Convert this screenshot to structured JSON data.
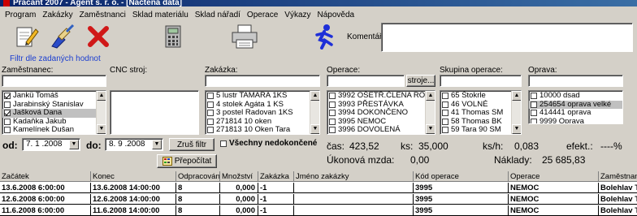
{
  "window": {
    "title": "Pracant 2007 - Agent s. r. o. - [Načtená data]"
  },
  "menu": [
    "Program",
    "Zakázky",
    "Zaměstnanci",
    "Sklad materiálu",
    "Sklad nářadí",
    "Operace",
    "Výkazy",
    "Nápověda"
  ],
  "toolbar": {
    "comment_label": "Komentář:",
    "comment_value": ""
  },
  "filter": {
    "title": "Filtr dle zadaných hodnot",
    "employee_label": "Zaměstnanec:",
    "cnc_label": "CNC stroj:",
    "order_label": "Zakázka:",
    "operation_label": "Operace:",
    "machines_button": "stroje...",
    "op_group_label": "Skupina operace:",
    "repair_label": "Oprava:",
    "employee_value": "",
    "order_value": "",
    "operation_value": "",
    "op_group_value": "",
    "repair_value": ""
  },
  "employees": [
    {
      "label": "Jankü Tomáš",
      "checked": true,
      "selected": false
    },
    {
      "label": "Jarabinský Stanislav",
      "checked": false,
      "selected": false
    },
    {
      "label": "Jašková Dana",
      "checked": true,
      "selected": true
    },
    {
      "label": "Kadaňka Jakub",
      "checked": false,
      "selected": false
    },
    {
      "label": "Kamelínek Dušan",
      "checked": false,
      "selected": false
    }
  ],
  "orders": [
    "5 lustr TAMARA 1KS",
    "4 stolek Agáta 1 KS",
    "3 postel Radovan 1KS",
    "271814 10 oken",
    "271813 10 Oken Tara"
  ],
  "operations": [
    "3992 OŠETŘ.ČLENA RO",
    "3993 PŘESTÁVKA",
    "3994 DOKONČENO",
    "3995 NEMOC",
    "3996 DOVOLENÁ"
  ],
  "op_groups": [
    "65 Štokrle",
    "46 VOLNÉ",
    "41 Thomas  SM",
    "58 Thomas  BK",
    "59 Tara 90 SM"
  ],
  "repairs": [
    {
      "label": "10000 dsad",
      "selected": false
    },
    {
      "label": "254654 oprava velké",
      "selected": true
    },
    {
      "label": "414441 oprava",
      "selected": false
    },
    {
      "label": "9999 Oprava",
      "selected": false
    }
  ],
  "dates": {
    "from_label": "od:",
    "from_value": "7. 1 .2008",
    "to_label": "do:",
    "to_value": "8. 9 .2008",
    "cancel_filter_button": "Zruš filtr",
    "all_unfinished_label": "Všechny nedokončené",
    "recalc_button": "Přepočítat"
  },
  "stats": {
    "time_label": "čas:",
    "time_value": "423,52",
    "pcs_label": "ks:",
    "pcs_value": "35,000",
    "rate_label": "ks/h:",
    "rate_value": "0,083",
    "eff_label": "efekt.:",
    "eff_value": "----%",
    "wage_label": "Úkonová mzda:",
    "wage_value": "0,00",
    "cost_label": "Náklady:",
    "cost_value": "25 685,83"
  },
  "table": {
    "columns": [
      "Začátek",
      "Konec",
      "Odpracováno",
      "Množství",
      "Zakázka",
      "Jméno zakázky",
      "Kód operace",
      "Operace",
      "Zaměstnan"
    ],
    "rows": [
      [
        "13.6.2008 6:00:00",
        "13.6.2008 14:00:00",
        "8",
        "0,000",
        "-1",
        "",
        "3995",
        "NEMOC",
        "Bolehlav T"
      ],
      [
        "12.6.2008 6:00:00",
        "12.6.2008 14:00:00",
        "8",
        "0,000",
        "-1",
        "",
        "3995",
        "NEMOC",
        "Bolehlav T"
      ],
      [
        "11.6.2008 6:00:00",
        "11.6.2008 14:00:00",
        "8",
        "0,000",
        "-1",
        "",
        "3995",
        "NEMOC",
        "Bolehlav T"
      ]
    ]
  },
  "colors": {
    "filter_title": "#1c3fd0",
    "titlebar": "#0a246a",
    "exit_red": "#d01818"
  },
  "icons": [
    "edit-notepad-icon",
    "cleanup-brush-icon",
    "delete-x-icon",
    "calculator-icon",
    "printer-icon",
    "runner-exit-icon"
  ]
}
